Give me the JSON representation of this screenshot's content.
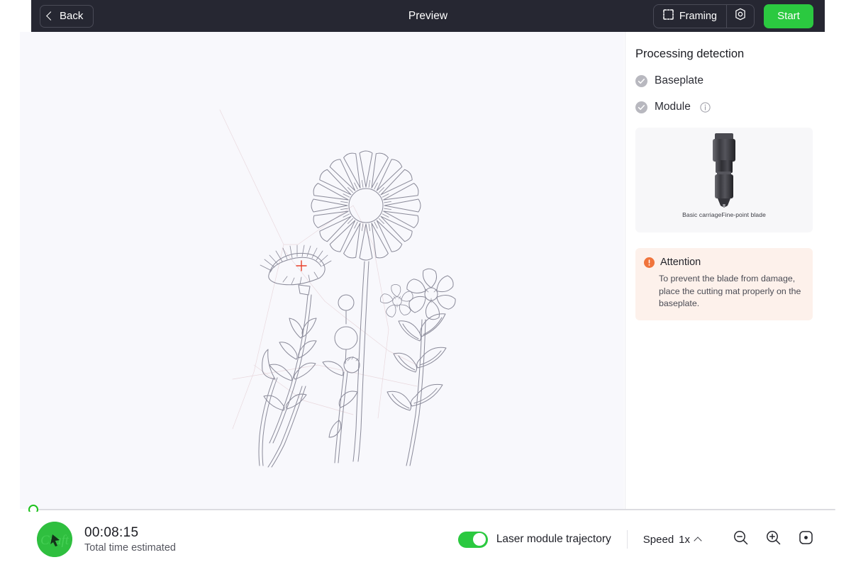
{
  "topbar": {
    "back_label": "Back",
    "title": "Preview",
    "framing_label": "Framing",
    "framing_icon": "framing-dashed-square-icon",
    "settings_icon": "gear-icon",
    "start_label": "Start",
    "start_color": "#2BC940",
    "background_color": "#262732"
  },
  "panel": {
    "title": "Processing detection",
    "checks": [
      {
        "label": "Baseplate",
        "icon": "check-circle-icon",
        "has_info": false
      },
      {
        "label": "Module",
        "icon": "check-circle-icon",
        "has_info": true,
        "info_icon": "info-icon"
      }
    ],
    "module_card": {
      "image": "blade-carriage-image",
      "caption": "Basic carriageFine-point blade"
    },
    "attention": {
      "icon": "exclamation-circle-icon",
      "title": "Attention",
      "body": "To prevent the blade from damage, place the cutting mat properly on the baseplate.",
      "accent_color": "#F0743C",
      "background_color": "#FDF1EB"
    }
  },
  "canvas": {
    "background_color": "#F8F8FC",
    "artwork_name": "wildflower-line-art",
    "stroke_color": "#8a8a99",
    "marker_color": "#E8402A",
    "marker_name": "laser-position-crosshair"
  },
  "timeline": {
    "handle_position_percent": 0,
    "handle_color": "#1CC11C",
    "track_color": "#dcdce1"
  },
  "bottombar": {
    "avatar_name": "app-logo-avatar",
    "time_value": "00:08:15",
    "time_caption": "Total time estimated",
    "trajectory_toggle": {
      "label": "Laser module trajectory",
      "state": "on",
      "color": "#2BC940"
    },
    "speed": {
      "label": "Speed",
      "value": "1x",
      "chevron": "chevron-up-icon"
    },
    "zoom_controls": [
      {
        "name": "zoom-out-button",
        "icon": "magnifier-minus-icon"
      },
      {
        "name": "zoom-in-button",
        "icon": "magnifier-plus-icon"
      },
      {
        "name": "fit-to-view-button",
        "icon": "center-target-icon"
      }
    ]
  }
}
